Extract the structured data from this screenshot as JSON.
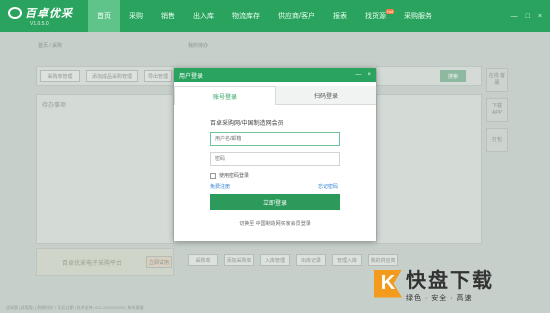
{
  "app": {
    "name": "百卓优采",
    "version": "V1.0.5.0"
  },
  "nav": {
    "items": [
      "首页",
      "采购",
      "销售",
      "出入库",
      "物流库存",
      "供应商/客户",
      "报表",
      "找货源",
      "采购服务"
    ],
    "badge": "hot",
    "active_index": 0
  },
  "window_controls": [
    "—",
    "□",
    "×"
  ],
  "background": {
    "crumb_left": "首页 / 采购",
    "crumb_right": "我的待办",
    "buttons_left": [
      "采购单管理",
      "添加成品采购管理",
      "导出管理"
    ],
    "section_title": "待办事项",
    "side_tiles": [
      "在线\n客服",
      "下载\nAPP",
      "打包"
    ],
    "search_btn": "搜索",
    "promo_text": "百卓优采电子采购平台",
    "promo_btn": "立即试用",
    "bottom_links": [
      "采购单",
      "添加采购单",
      "入库管理",
      "出库记录",
      "管理入库",
      "我的供应商"
    ],
    "footer": "优采版 (试用版)  |  到期时间 7 天后过期  |  技术支持: 021-XXXXXXXX  |  联系客服"
  },
  "dialog": {
    "title": "用户登录",
    "tabs": [
      "账号登录",
      "扫码登录"
    ],
    "active_tab": 0,
    "heading": "百卓采购网/中国制造网会员",
    "username_placeholder": "用户名/邮箱",
    "password_placeholder": "密码",
    "remember_label": "使用密码登录",
    "register_link": "免费注册",
    "forgot_link": "忘记密码",
    "login_button": "立即登录",
    "switch_text": "切换至 中国制造网买家会员登录"
  },
  "watermark": {
    "brand": "快盘下载",
    "tagline": "绿色 · 安全 · 高速",
    "glyph": "K"
  },
  "colors": {
    "primary": "#2aa35e",
    "link": "#2f7fd6",
    "watermark_orange": "#f29b1c"
  }
}
